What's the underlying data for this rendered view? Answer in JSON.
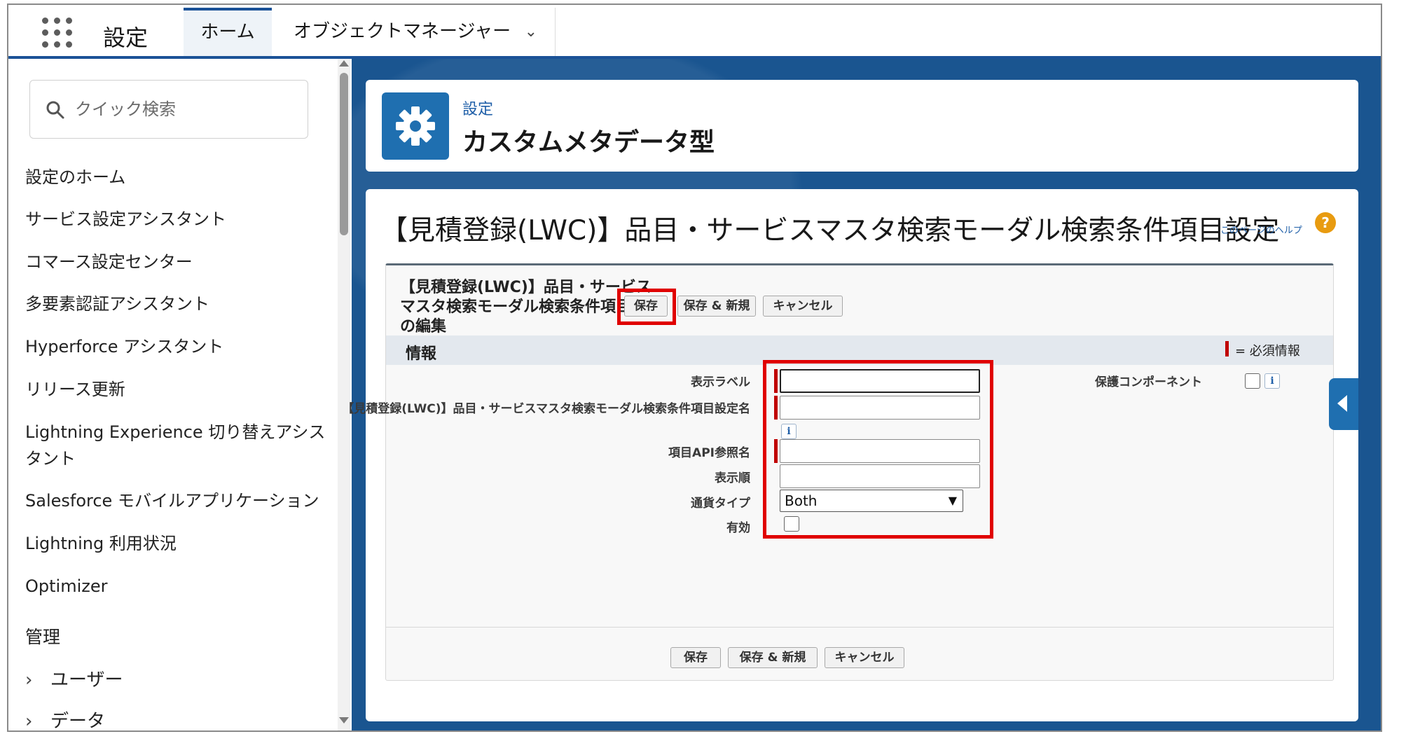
{
  "app": {
    "name": "設定"
  },
  "tabs": [
    {
      "label": "ホーム"
    },
    {
      "label": "オブジェクトマネージャー"
    }
  ],
  "sidebar": {
    "search_placeholder": "クイック検索",
    "items": [
      {
        "label": "設定のホーム"
      },
      {
        "label": "サービス設定アシスタント"
      },
      {
        "label": "コマース設定センター"
      },
      {
        "label": "多要素認証アシスタント"
      },
      {
        "label": "Hyperforce アシスタント"
      },
      {
        "label": "リリース更新"
      },
      {
        "label": "Lightning Experience 切り替えアシスタント"
      },
      {
        "label": "Salesforce モバイルアプリケーション"
      },
      {
        "label": "Lightning 利用状況"
      },
      {
        "label": "Optimizer"
      }
    ],
    "group_label": "管理",
    "sub_items": [
      {
        "label": "ユーザー"
      },
      {
        "label": "データ"
      }
    ]
  },
  "header": {
    "breadcrumb": "設定",
    "title": "カスタムメタデータ型"
  },
  "page": {
    "title": "【見積登録(LWC)】品目・サービスマスタ検索モーダル検索条件項目設定",
    "help_link": "このページのヘルプ"
  },
  "edit_block": {
    "title": "【見積登録(LWC)】品目・サービスマスタ検索モーダル検索条件項目設定の編集",
    "buttons": {
      "save": "保存",
      "save_new": "保存 & 新規",
      "cancel": "キャンセル"
    },
    "section_title": "情報",
    "required_legend": "= 必須情報",
    "fields": {
      "display_label": {
        "label": "表示ラベル",
        "value": ""
      },
      "object_name": {
        "label": "【見積登録(LWC)】品目・サービスマスタ検索モーダル検索条件項目設定名",
        "value": ""
      },
      "field_api_name": {
        "label": "項目API参照名",
        "value": ""
      },
      "display_order": {
        "label": "表示順",
        "value": ""
      },
      "currency_type": {
        "label": "通貨タイプ",
        "value": "Both"
      },
      "active": {
        "label": "有効",
        "checked": false
      },
      "protected_component": {
        "label": "保護コンポーネント",
        "checked": false
      }
    }
  },
  "colors": {
    "brand_blue": "#1b5297",
    "highlight_red": "#e00000",
    "required_red": "#c00000",
    "help_orange": "#e89b10"
  }
}
